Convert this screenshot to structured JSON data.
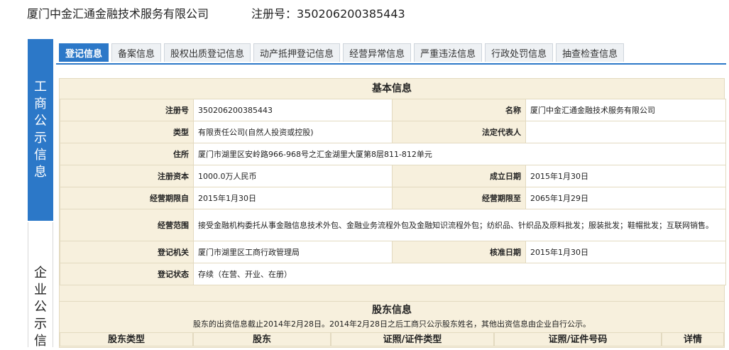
{
  "header": {
    "company_name": "厦门中金汇通金融技术服务有限公司",
    "registration_number": "注册号：350206200385443"
  },
  "sidebar": {
    "primary_label": [
      "工",
      "商",
      "公",
      "示",
      "信",
      "息"
    ],
    "secondary_label": [
      "企",
      "业",
      "公",
      "示",
      "信"
    ]
  },
  "tabs": [
    {
      "label": "登记信息",
      "active": true
    },
    {
      "label": "备案信息"
    },
    {
      "label": "股权出质登记信息"
    },
    {
      "label": "动产抵押登记信息"
    },
    {
      "label": "经营异常信息"
    },
    {
      "label": "严重违法信息"
    },
    {
      "label": "行政处罚信息"
    },
    {
      "label": "抽查检查信息"
    }
  ],
  "basic_info": {
    "title": "基本信息",
    "reg_no_label": "注册号",
    "reg_no": "350206200385443",
    "name_label": "名称",
    "name": "厦门中金汇通金融技术服务有限公司",
    "type_label": "类型",
    "type": "有限责任公司(自然人投资或控股)",
    "legal_rep_label": "法定代表人",
    "legal_rep": "",
    "address_label": "住所",
    "address": "厦门市湖里区安岭路966-968号之汇金湖里大厦第8层811-812单元",
    "capital_label": "注册资本",
    "capital": "1000.0万人民币",
    "established_label": "成立日期",
    "established": "2015年1月30日",
    "term_from_label": "经营期限自",
    "term_from": "2015年1月30日",
    "term_to_label": "经营期限至",
    "term_to": "2065年1月29日",
    "scope_label": "经营范围",
    "scope": "接受金融机构委托从事金融信息技术外包、金融业务流程外包及金融知识流程外包；纺织品、针织品及原料批发；服装批发；鞋帽批发；互联网销售。",
    "authority_label": "登记机关",
    "authority": "厦门市湖里区工商行政管理局",
    "approval_label": "核准日期",
    "approval": "2015年1月30日",
    "status_label": "登记状态",
    "status": "存续（在营、开业、在册）"
  },
  "shareholder_info": {
    "title": "股东信息",
    "note": "股东的出资信息截止2014年2月28日。2014年2月28日之后工商只公示股东姓名，其他出资信息由企业自行公示。",
    "columns": [
      "股东类型",
      "股东",
      "证照/证件类型",
      "证照/证件号码",
      "详情"
    ]
  },
  "colors": {
    "accent": "#2c78c8",
    "label_bg": "#f7f0dd"
  }
}
